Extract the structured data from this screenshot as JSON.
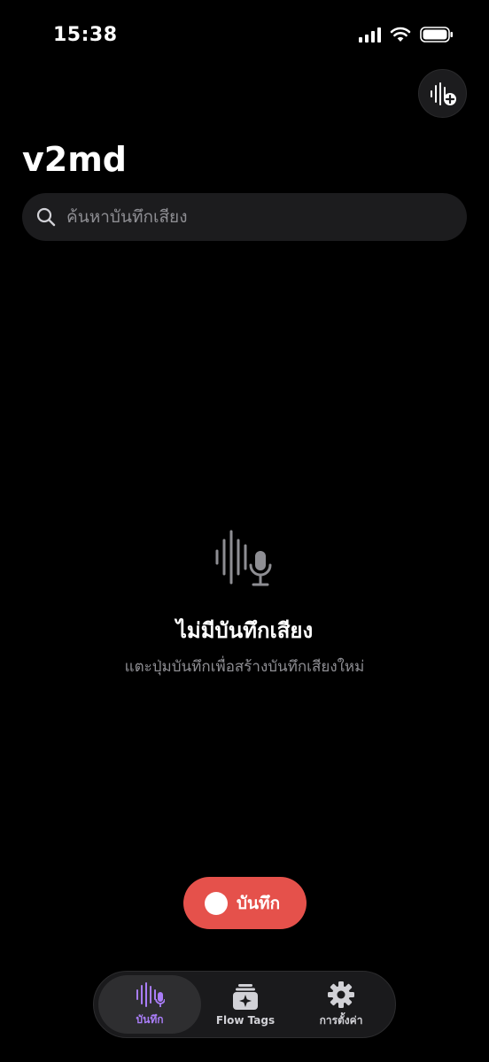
{
  "status_bar": {
    "time": "15:38"
  },
  "header": {
    "title": "v2md",
    "action_icon": "waveform-plus-icon"
  },
  "search": {
    "placeholder": "ค้นหาบันทึกเสียง",
    "value": ""
  },
  "empty_state": {
    "icon": "waveform-mic-icon",
    "title": "ไม่มีบันทึกเสียง",
    "subtitle": "แตะปุ่มบันทึกเพื่อสร้างบันทึกเสียงใหม่"
  },
  "record_button": {
    "label": "บันทึก"
  },
  "tab_bar": {
    "tabs": [
      {
        "label": "บันทึก",
        "icon": "waveform-mic-icon",
        "active": true
      },
      {
        "label": "Flow Tags",
        "icon": "sparkle-stack-icon",
        "active": false
      },
      {
        "label": "การตั้งค่า",
        "icon": "gear-icon",
        "active": false
      }
    ]
  },
  "colors": {
    "background": "#000000",
    "surface": "#1c1c1e",
    "record_red": "#e5514b",
    "accent_purple": "#a97df7",
    "secondary_text": "#8e8e93"
  }
}
